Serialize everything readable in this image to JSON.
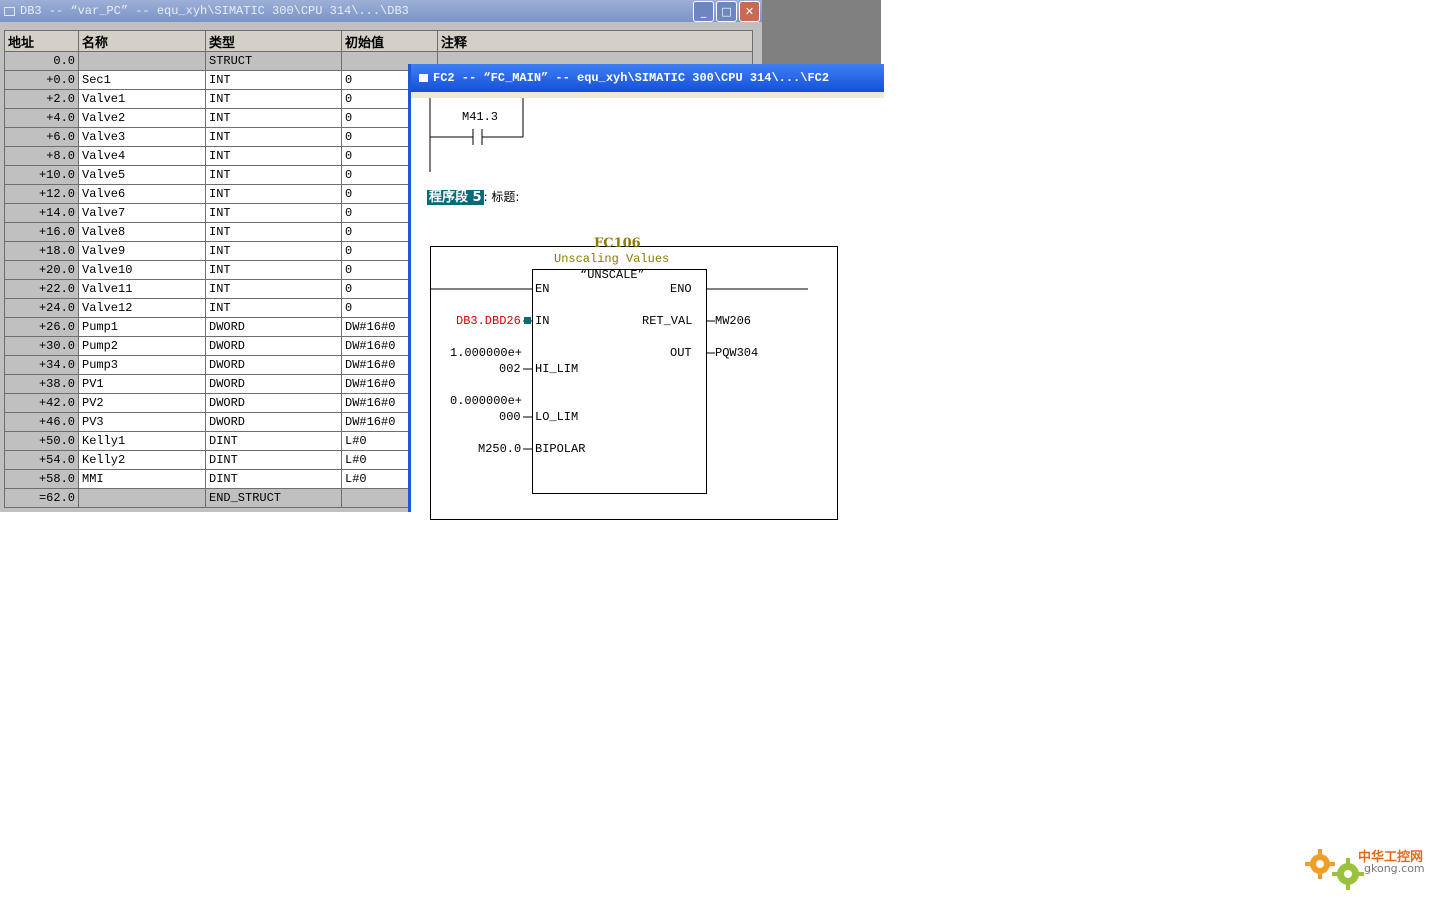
{
  "db_window": {
    "title": "DB3 -- “var_PC” -- equ_xyh\\SIMATIC 300\\CPU 314\\...\\DB3",
    "buttons": {
      "minimize": "_",
      "maximize": "□",
      "close": "✕"
    },
    "headers": [
      "地址",
      "名称",
      "类型",
      "初始值",
      "注释"
    ],
    "rows": [
      {
        "addr": "0.0",
        "name": "",
        "type": "STRUCT",
        "init": ""
      },
      {
        "addr": "+0.0",
        "name": "Sec1",
        "type": "INT",
        "init": "0"
      },
      {
        "addr": "+2.0",
        "name": "Valve1",
        "type": "INT",
        "init": "0"
      },
      {
        "addr": "+4.0",
        "name": "Valve2",
        "type": "INT",
        "init": "0"
      },
      {
        "addr": "+6.0",
        "name": "Valve3",
        "type": "INT",
        "init": "0"
      },
      {
        "addr": "+8.0",
        "name": "Valve4",
        "type": "INT",
        "init": "0"
      },
      {
        "addr": "+10.0",
        "name": "Valve5",
        "type": "INT",
        "init": "0"
      },
      {
        "addr": "+12.0",
        "name": "Valve6",
        "type": "INT",
        "init": "0"
      },
      {
        "addr": "+14.0",
        "name": "Valve7",
        "type": "INT",
        "init": "0"
      },
      {
        "addr": "+16.0",
        "name": "Valve8",
        "type": "INT",
        "init": "0"
      },
      {
        "addr": "+18.0",
        "name": "Valve9",
        "type": "INT",
        "init": "0"
      },
      {
        "addr": "+20.0",
        "name": "Valve10",
        "type": "INT",
        "init": "0"
      },
      {
        "addr": "+22.0",
        "name": "Valve11",
        "type": "INT",
        "init": "0"
      },
      {
        "addr": "+24.0",
        "name": "Valve12",
        "type": "INT",
        "init": "0"
      },
      {
        "addr": "+26.0",
        "name": "Pump1",
        "type": "DWORD",
        "init": "DW#16#0"
      },
      {
        "addr": "+30.0",
        "name": "Pump2",
        "type": "DWORD",
        "init": "DW#16#0"
      },
      {
        "addr": "+34.0",
        "name": "Pump3",
        "type": "DWORD",
        "init": "DW#16#0"
      },
      {
        "addr": "+38.0",
        "name": "PV1",
        "type": "DWORD",
        "init": "DW#16#0"
      },
      {
        "addr": "+42.0",
        "name": "PV2",
        "type": "DWORD",
        "init": "DW#16#0"
      },
      {
        "addr": "+46.0",
        "name": "PV3",
        "type": "DWORD",
        "init": "DW#16#0"
      },
      {
        "addr": "+50.0",
        "name": "Kelly1",
        "type": "DINT",
        "init": "L#0"
      },
      {
        "addr": "+54.0",
        "name": "Kelly2",
        "type": "DINT",
        "init": "L#0"
      },
      {
        "addr": "+58.0",
        "name": "MMI",
        "type": "DINT",
        "init": "L#0"
      },
      {
        "addr": "=62.0",
        "name": "",
        "type": "END_STRUCT",
        "init": ""
      }
    ]
  },
  "fc_window": {
    "title": "FC2 -- “FC_MAIN” -- equ_xyh\\SIMATIC 300\\CPU 314\\...\\FC2",
    "contact_label": "M41.3",
    "network_label": "程序段 5",
    "network_title": ": 标题:",
    "block": {
      "name": "FC106",
      "description": "Unscaling Values",
      "symbol": "“UNSCALE”",
      "pin_en": "EN",
      "pin_eno": "ENO",
      "pin_in": "IN",
      "pin_hi_lim": "HI_LIM",
      "pin_lo_lim": "LO_LIM",
      "pin_bipolar": "BIPOLAR",
      "pin_ret_val": "RET_VAL",
      "pin_out": "OUT"
    },
    "operands": {
      "in": "DB3.DBD26",
      "hi_lim_1": "1.000000e+",
      "hi_lim_2": "002",
      "lo_lim_1": "0.000000e+",
      "lo_lim_2": "000",
      "bipolar": "M250.0",
      "ret_val": "MW206",
      "out": "PQW304"
    }
  },
  "watermark": {
    "name": "中华工控网",
    "site": "gkong.com"
  },
  "colors": {
    "active_title": "#1450d8",
    "inactive_title": "#7a94c8",
    "block_text": "#8a7a00",
    "operand_red": "#d40000",
    "highlight": "#0a6a78"
  }
}
